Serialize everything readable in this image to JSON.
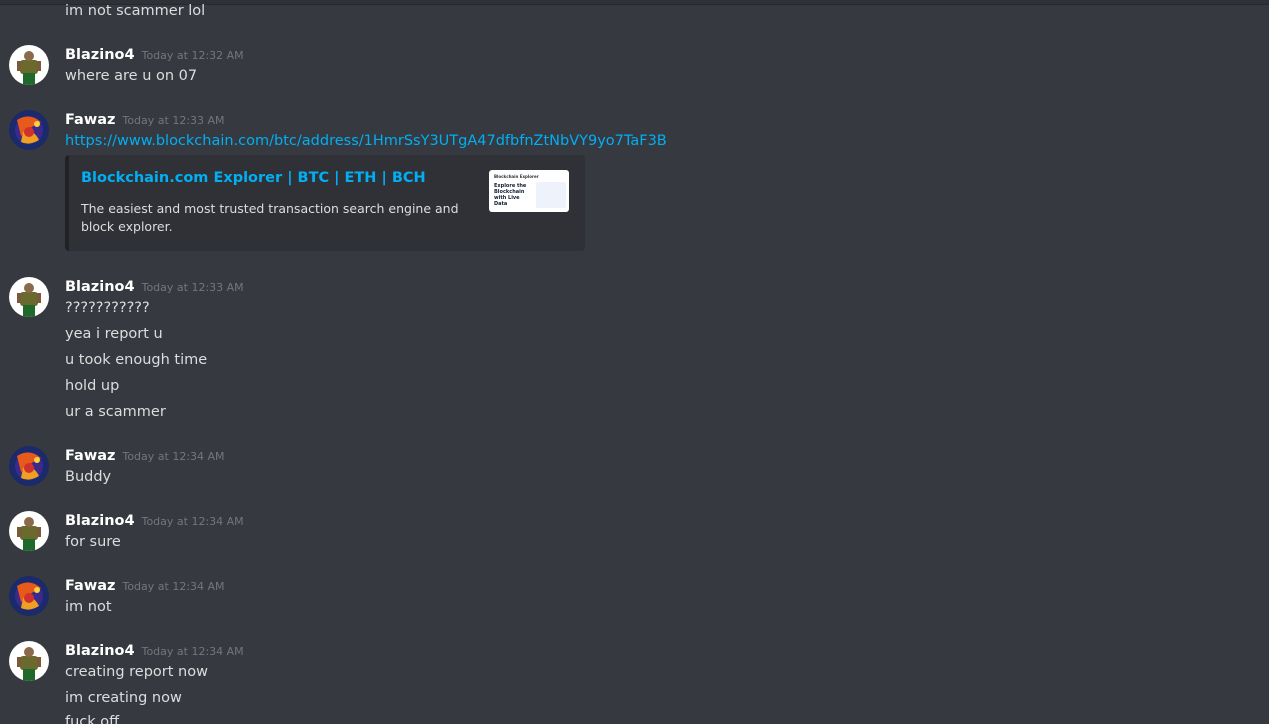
{
  "users": {
    "blazino": "Blazino4",
    "fawaz": "Fawaz"
  },
  "messages": [
    {
      "text": "im not scammer lol"
    },
    {
      "author": "Blazino4",
      "time": "Today at 12:32 AM",
      "lines": [
        "where are u on 07"
      ]
    },
    {
      "author": "Fawaz",
      "time": "Today at 12:33 AM",
      "link": "https://www.blockchain.com/btc/address/1HmrSsY3UTgA47dfbfnZtNbVY9yo7TaF3B"
    },
    {
      "author": "Blazino4",
      "time": "Today at 12:33 AM",
      "lines": [
        "???????????",
        "yea i report u",
        "u took enough time",
        "hold up",
        "ur a scammer"
      ]
    },
    {
      "author": "Fawaz",
      "time": "Today at 12:34 AM",
      "lines": [
        "Buddy"
      ]
    },
    {
      "author": "Blazino4",
      "time": "Today at 12:34 AM",
      "lines": [
        "for sure"
      ]
    },
    {
      "author": "Fawaz",
      "time": "Today at 12:34 AM",
      "lines": [
        "im not"
      ]
    },
    {
      "author": "Blazino4",
      "time": "Today at 12:34 AM",
      "lines": [
        "creating report now",
        "im creating now",
        "fuck off"
      ]
    }
  ],
  "embed": {
    "title": "Blockchain.com Explorer | BTC | ETH | BCH",
    "description": "The easiest and most trusted transaction search engine and block explorer.",
    "thumbnail": {
      "brand": "Blockchain Explorer",
      "headline": "Explore the Blockchain with Live Data"
    }
  },
  "colors": {
    "background": "#36393f",
    "link": "#00aff4",
    "username": "#ffffff",
    "timestamp": "#72767d",
    "text": "#dcddde",
    "embed_bg": "#2f3136"
  },
  "icons": {
    "blazino_avatar": "avatar-blazino-icon",
    "fawaz_avatar": "avatar-fawaz-icon"
  }
}
